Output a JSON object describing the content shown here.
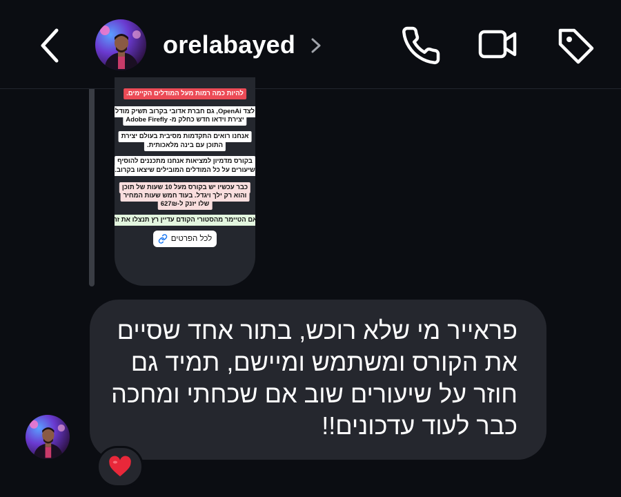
{
  "header": {
    "username": "orelabayed",
    "icons": [
      "back-chevron-icon",
      "chevron-right-icon",
      "phone-icon",
      "video-camera-icon",
      "tag-icon"
    ]
  },
  "shared_post": {
    "lines": [
      "להיות כמה רמות מעל המודלים הקיימים.",
      "לצד OpenAi, גם חברת אדובי בקרוב תשיק מודל",
      "יצירת וידאו חדש כחלק מ- Adobe Firefly",
      "אנחנו רואים התקדמות מסיבית בעולם יצירת",
      "התוכן עם בינה מלאכותית.",
      "בקורס מדמיון למציאות אנחנו מתכננים להוסיף",
      "שיעורים על כל המודלים המובילים שיצאו בקרוב.",
      "כבר עכשיו יש בקורס מעל 10 שעות של תוכן",
      "והוא רק ילך ויגדל. בעוד חמש שעות המחיר",
      "שלו יזנק ל-627₪",
      "אם הטיימר מהסטורי הקודם עדיין רץ תנצלו את זה"
    ],
    "link_label": "לכל הפרטים"
  },
  "message": {
    "lines": [
      "פראייר מי שלא רוכש, בתור אחד שסיים",
      "את הקורס ומשתמש ומיישם, תמיד גם",
      "חוזר על שיעורים שוב אם שכחתי ומחכה",
      "כבר לעוד עדכונים!!"
    ]
  },
  "reaction": {
    "emoji": "❤️"
  },
  "colors": {
    "background": "#0b0d12",
    "bubble": "#25272e",
    "reaction_heart": "#e8283a"
  }
}
